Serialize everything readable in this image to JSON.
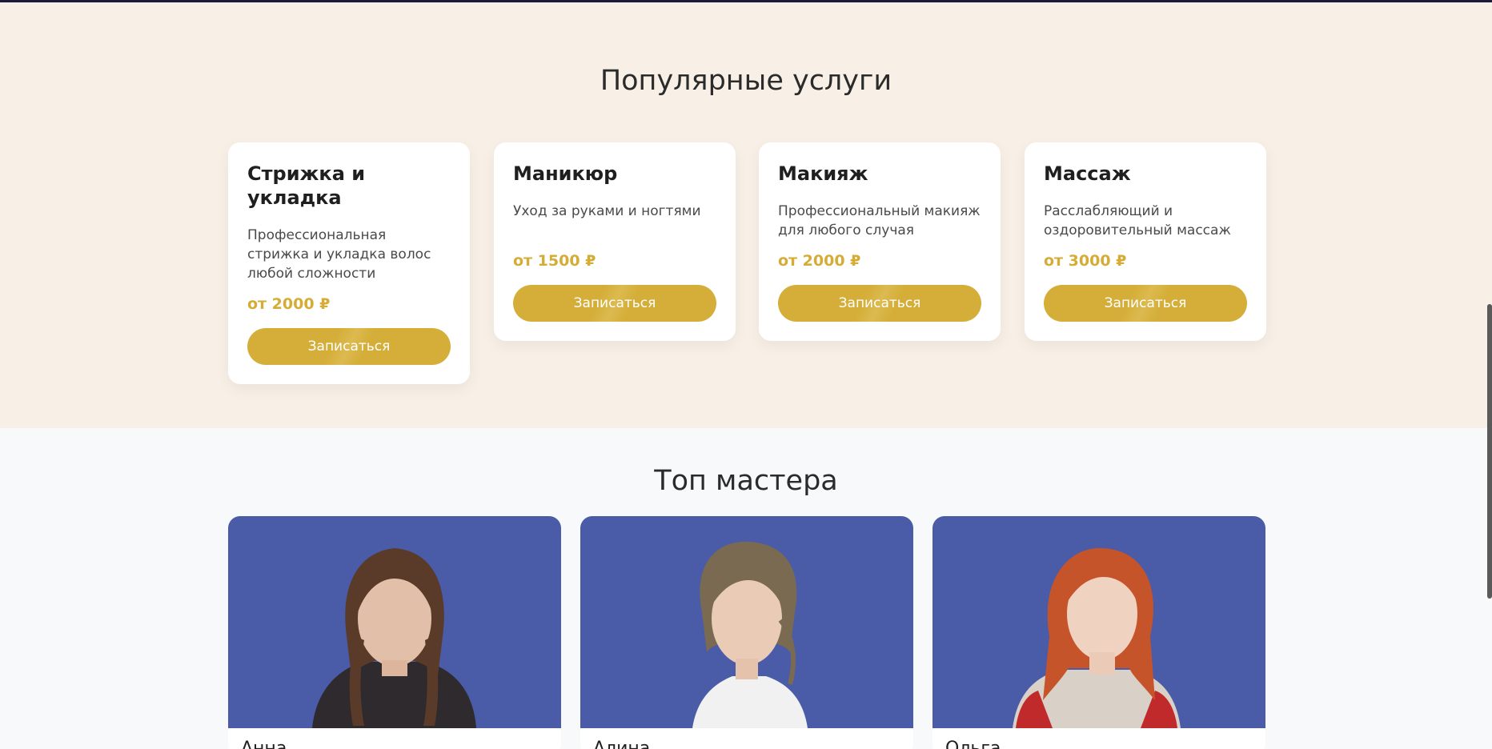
{
  "services": {
    "title": "Популярные услуги",
    "items": [
      {
        "name": "Стрижка и укладка",
        "description": "Профессиональная стрижка и укладка волос любой сложности",
        "price": "от 2000 ₽",
        "button": "Записаться"
      },
      {
        "name": "Маникюр",
        "description": "Уход за руками и ногтями",
        "price": "от 1500 ₽",
        "button": "Записаться"
      },
      {
        "name": "Макияж",
        "description": "Профессиональный макияж для любого случая",
        "price": "от 2000 ₽",
        "button": "Записаться"
      },
      {
        "name": "Массаж",
        "description": "Расслабляющий и оздоровительный массаж",
        "price": "от 3000 ₽",
        "button": "Записаться"
      }
    ]
  },
  "masters": {
    "title": "Топ мастера",
    "items": [
      {
        "name": "Анна"
      },
      {
        "name": "Алина"
      },
      {
        "name": "Ольга"
      }
    ]
  },
  "colors": {
    "accent": "#d4ae38",
    "services_bg": "#f8f0e6",
    "masters_bg": "#f8f9fa",
    "photo_bg": "#4a5ba8"
  }
}
